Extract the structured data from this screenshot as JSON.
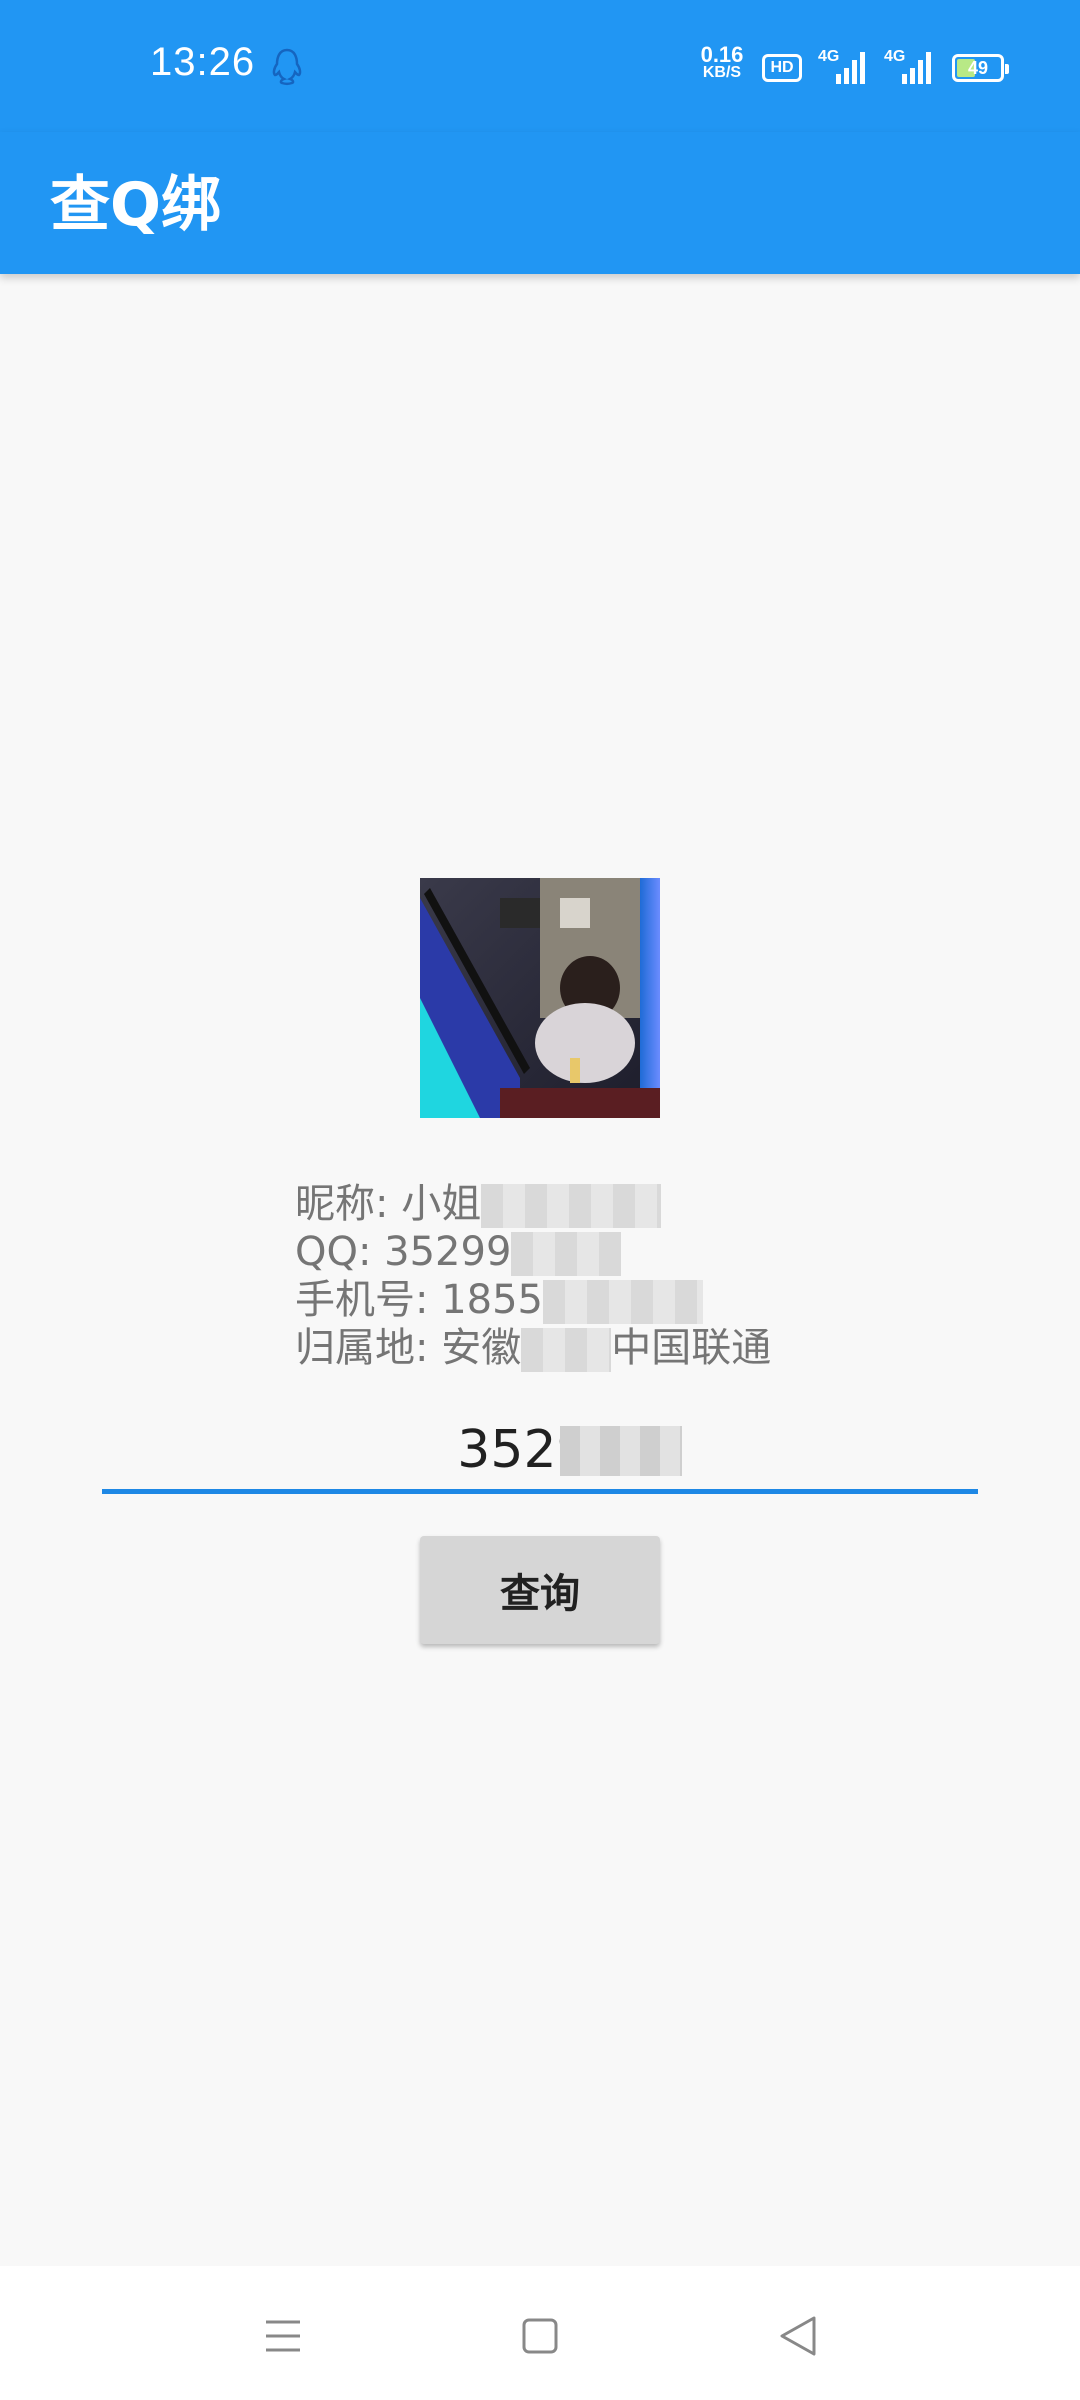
{
  "status_bar": {
    "time": "13:26",
    "net_speed_value": "0.16",
    "net_speed_unit": "KB/S",
    "hd_label": "HD",
    "signal_1_label": "4G",
    "signal_2_label": "4G",
    "battery_level": "49",
    "icons": [
      "qq-notification-icon",
      "hd-voice-icon",
      "signal-icon",
      "signal-icon",
      "battery-icon"
    ]
  },
  "app_bar": {
    "title": "查Q绑",
    "background_color": "#2196f3"
  },
  "profile": {
    "avatar_alt": "avatar-photo",
    "nickname_label": "昵称: 小姐",
    "qq_label": "QQ: 35299",
    "phone_label": "手机号: 1855",
    "location_label": "归属地: 安徽",
    "location_carrier": "中国联通"
  },
  "query": {
    "input_value": "35299",
    "button_label": "查询",
    "accent_color": "#1e88e5"
  },
  "nav_bar": {
    "icons": [
      "menu-icon",
      "home-icon",
      "back-icon"
    ]
  }
}
